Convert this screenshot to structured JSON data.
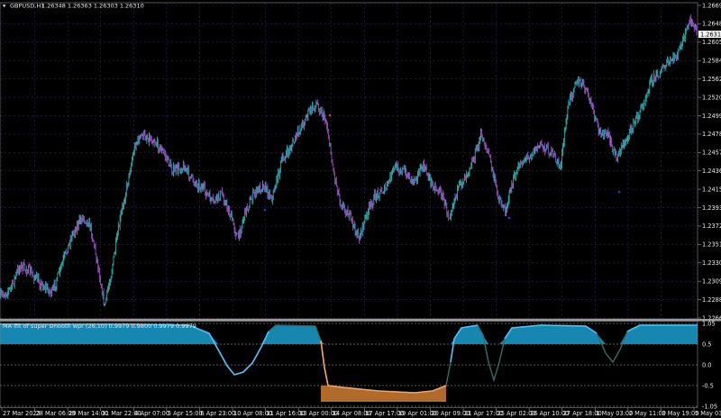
{
  "title_bar": {
    "symbol_label": "GBPUSD,H1",
    "ohlc_label": "1.26348 1.26363 1.26303 1.26310"
  },
  "indicator": {
    "label": "MA lfit of super smooth wpr (26,10) 0.9979 0.9800 0.9979 0.9979"
  },
  "colors": {
    "background": "#000000",
    "grid": "#2a2a5a",
    "bull_candle": "#2bb3b0",
    "bear_candle": "#9a4ec0",
    "indicator_line_up": "#4fc3f7",
    "indicator_line_down": "#2f6f69",
    "indicator_fill_up": "#1687b1",
    "indicator_fill_down": "#b06a2a",
    "indicator_line_low": "#f4a46b",
    "marker_sell": "#e53935",
    "marker_buy": "#1e3bd6"
  },
  "price_axis": {
    "labels": [
      "1.26690",
      "1.26480",
      "1.26055",
      "1.25840",
      "1.25625",
      "1.25205",
      "1.24995",
      "1.24780",
      "1.24570",
      "1.24360",
      "1.24150",
      "1.23935",
      "1.23720",
      "1.23510",
      "1.23300",
      "1.23090",
      "1.22880",
      "1.22665"
    ],
    "current_price": "1.26310"
  },
  "indicator_axis": {
    "labels": [
      "1.05",
      "0.5",
      "0.0",
      "-0.5",
      "-1.05"
    ]
  },
  "time_axis": {
    "labels": [
      "27 Mar 2023",
      "28 Mar 06:00",
      "29 Mar 14:00",
      "31 Mar 22:00",
      "4 Apr 07:00",
      "5 Apr 15:00",
      "6 Apr 23:00",
      "10 Apr 08:00",
      "11 Apr 16:00",
      "13 Apr 00:00",
      "14 Apr 08:00",
      "17 Apr 17:00",
      "19 Apr 01:00",
      "20 Apr 09:00",
      "21 Apr 17:00",
      "25 Apr 02:00",
      "26 Apr 10:00",
      "27 Apr 18:00",
      "1 May 03:00",
      "2 May 11:00",
      "3 May 19:00",
      "5 May 03:00"
    ]
  }
}
